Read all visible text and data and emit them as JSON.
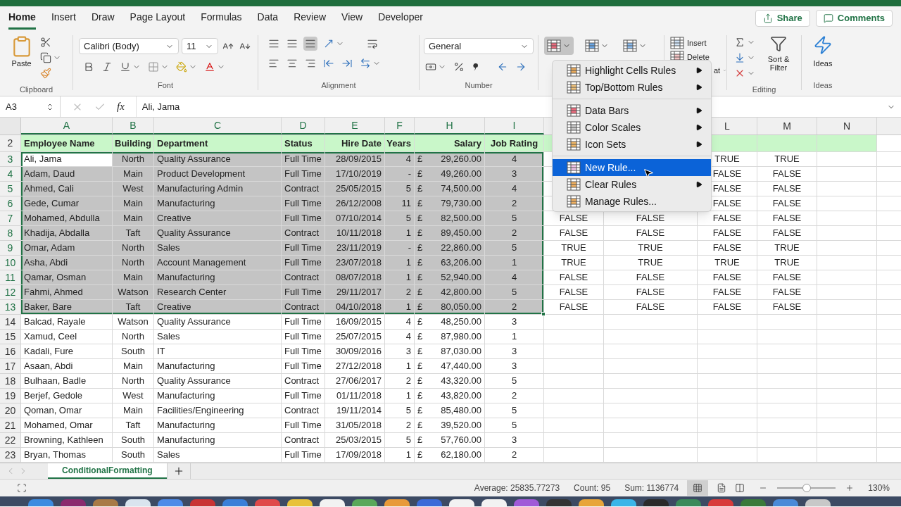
{
  "tabs": [
    {
      "label": "Home",
      "selected": true
    },
    {
      "label": "Insert",
      "selected": false
    },
    {
      "label": "Draw",
      "selected": false
    },
    {
      "label": "Page Layout",
      "selected": false
    },
    {
      "label": "Formulas",
      "selected": false
    },
    {
      "label": "Data",
      "selected": false
    },
    {
      "label": "Review",
      "selected": false
    },
    {
      "label": "View",
      "selected": false
    },
    {
      "label": "Developer",
      "selected": false
    }
  ],
  "share": "Share",
  "comments": "Comments",
  "ribbon": {
    "clipboard": {
      "paste": "Paste",
      "label": "Clipboard"
    },
    "font": {
      "name": "Calibri (Body)",
      "size": "11",
      "label": "Font"
    },
    "alignment": {
      "label": "Alignment"
    },
    "number": {
      "format": "General",
      "label": "Number"
    },
    "styles": {
      "conditional_formatting_open": true
    },
    "cells": {
      "insert": "Insert",
      "delete": "Delete",
      "format": "at"
    },
    "editing": {
      "sort_filter": "Sort & Filter",
      "label": "Editing"
    },
    "ideas": {
      "button": "Ideas",
      "label": "Ideas"
    }
  },
  "formula_bar": {
    "name_box": "A3",
    "fx": "fx",
    "value": "Ali, Jama"
  },
  "sheet": {
    "columns": [
      {
        "label": "A",
        "selected": true
      },
      {
        "label": "B",
        "selected": true
      },
      {
        "label": "C",
        "selected": true
      },
      {
        "label": "D",
        "selected": true
      },
      {
        "label": "E",
        "selected": true
      },
      {
        "label": "F",
        "selected": true
      },
      {
        "label": "H",
        "selected": true
      },
      {
        "label": "I",
        "selected": true
      },
      {},
      {},
      {
        "label": "L",
        "selected": false
      },
      {
        "label": "M",
        "selected": false
      },
      {
        "label": "N",
        "selected": false
      }
    ],
    "rows": [
      {
        "number": "2",
        "kind": "header",
        "selected": false,
        "active": false,
        "cells": [
          "Employee Name",
          "Building",
          "Department",
          "Status",
          "Hire Date",
          "Years",
          "Salary",
          "Job Rating"
        ]
      },
      {
        "number": "3",
        "kind": "data",
        "selected": true,
        "active": true,
        "cells": [
          "Ali, Jama",
          "North",
          "Quality Assurance",
          "Full Time",
          "28/09/2015",
          "4",
          {
            "currency": "£",
            "amount": "29,260.00"
          },
          "4",
          null,
          null,
          "TRUE",
          "TRUE"
        ]
      },
      {
        "number": "4",
        "kind": "data",
        "selected": true,
        "active": false,
        "cells": [
          "Adam, Daud",
          "Main",
          "Product Development",
          "Full Time",
          "17/10/2019",
          "-",
          {
            "currency": "£",
            "amount": "49,260.00"
          },
          "3",
          null,
          null,
          "FALSE",
          "FALSE"
        ]
      },
      {
        "number": "5",
        "kind": "data",
        "selected": true,
        "active": false,
        "cells": [
          "Ahmed, Cali",
          "West",
          "Manufacturing Admin",
          "Contract",
          "25/05/2015",
          "5",
          {
            "currency": "£",
            "amount": "74,500.00"
          },
          "4",
          null,
          null,
          "FALSE",
          "FALSE"
        ]
      },
      {
        "number": "6",
        "kind": "data",
        "selected": true,
        "active": false,
        "cells": [
          "Gede, Cumar",
          "Main",
          "Manufacturing",
          "Full Time",
          "26/12/2008",
          "11",
          {
            "currency": "£",
            "amount": "79,730.00"
          },
          "2",
          null,
          null,
          "FALSE",
          "FALSE"
        ]
      },
      {
        "number": "7",
        "kind": "data",
        "selected": true,
        "active": false,
        "cells": [
          "Mohamed, Abdulla",
          "Main",
          "Creative",
          "Full Time",
          "07/10/2014",
          "5",
          {
            "currency": "£",
            "amount": "82,500.00"
          },
          "5",
          "FALSE",
          "FALSE",
          "FALSE",
          "FALSE"
        ]
      },
      {
        "number": "8",
        "kind": "data",
        "selected": true,
        "active": false,
        "cells": [
          "Khadija, Abdalla",
          "Taft",
          "Quality Assurance",
          "Contract",
          "10/11/2018",
          "1",
          {
            "currency": "£",
            "amount": "89,450.00"
          },
          "2",
          "FALSE",
          "FALSE",
          "FALSE",
          "FALSE"
        ]
      },
      {
        "number": "9",
        "kind": "data",
        "selected": true,
        "active": false,
        "cells": [
          "Omar, Adam",
          "North",
          "Sales",
          "Full Time",
          "23/11/2019",
          "-",
          {
            "currency": "£",
            "amount": "22,860.00"
          },
          "5",
          "TRUE",
          "TRUE",
          "FALSE",
          "TRUE"
        ]
      },
      {
        "number": "10",
        "kind": "data",
        "selected": true,
        "active": false,
        "cells": [
          "Asha, Abdi",
          "North",
          "Account Management",
          "Full Time",
          "23/07/2018",
          "1",
          {
            "currency": "£",
            "amount": "63,206.00"
          },
          "1",
          "TRUE",
          "TRUE",
          "TRUE",
          "TRUE"
        ]
      },
      {
        "number": "11",
        "kind": "data",
        "selected": true,
        "active": false,
        "cells": [
          "Qamar, Osman",
          "Main",
          "Manufacturing",
          "Contract",
          "08/07/2018",
          "1",
          {
            "currency": "£",
            "amount": "52,940.00"
          },
          "4",
          "FALSE",
          "FALSE",
          "FALSE",
          "FALSE"
        ]
      },
      {
        "number": "12",
        "kind": "data",
        "selected": true,
        "active": false,
        "cells": [
          "Fahmi, Ahmed",
          "Watson",
          "Research Center",
          "Full Time",
          "29/11/2017",
          "2",
          {
            "currency": "£",
            "amount": "42,800.00"
          },
          "5",
          "FALSE",
          "FALSE",
          "FALSE",
          "FALSE"
        ]
      },
      {
        "number": "13",
        "kind": "data",
        "selected": true,
        "active": false,
        "cells": [
          "Baker, Bare",
          "Taft",
          "Creative",
          "Contract",
          "04/10/2018",
          "1",
          {
            "currency": "£",
            "amount": "80,050.00"
          },
          "2",
          "FALSE",
          "FALSE",
          "FALSE",
          "FALSE"
        ]
      },
      {
        "number": "14",
        "kind": "data",
        "selected": false,
        "active": false,
        "cells": [
          "Balcad, Rayale",
          "Watson",
          "Quality Assurance",
          "Full Time",
          "16/09/2015",
          "4",
          {
            "currency": "£",
            "amount": "48,250.00"
          },
          "3"
        ]
      },
      {
        "number": "15",
        "kind": "data",
        "selected": false,
        "active": false,
        "cells": [
          "Xamud, Ceel",
          "North",
          "Sales",
          "Full Time",
          "25/07/2015",
          "4",
          {
            "currency": "£",
            "amount": "87,980.00"
          },
          "1"
        ]
      },
      {
        "number": "16",
        "kind": "data",
        "selected": false,
        "active": false,
        "cells": [
          "Kadali, Fure",
          "South",
          "IT",
          "Full Time",
          "30/09/2016",
          "3",
          {
            "currency": "£",
            "amount": "87,030.00"
          },
          "3"
        ]
      },
      {
        "number": "17",
        "kind": "data",
        "selected": false,
        "active": false,
        "cells": [
          "Asaan, Abdi",
          "Main",
          "Manufacturing",
          "Full Time",
          "27/12/2018",
          "1",
          {
            "currency": "£",
            "amount": "47,440.00"
          },
          "3"
        ]
      },
      {
        "number": "18",
        "kind": "data",
        "selected": false,
        "active": false,
        "cells": [
          "Bulhaan, Badle",
          "North",
          "Quality Assurance",
          "Contract",
          "27/06/2017",
          "2",
          {
            "currency": "£",
            "amount": "43,320.00"
          },
          "5"
        ]
      },
      {
        "number": "19",
        "kind": "data",
        "selected": false,
        "active": false,
        "cells": [
          "Berjef, Gedole",
          "West",
          "Manufacturing",
          "Full Time",
          "01/11/2018",
          "1",
          {
            "currency": "£",
            "amount": "43,820.00"
          },
          "2"
        ]
      },
      {
        "number": "20",
        "kind": "data",
        "selected": false,
        "active": false,
        "cells": [
          "Qoman, Omar",
          "Main",
          "Facilities/Engineering",
          "Contract",
          "19/11/2014",
          "5",
          {
            "currency": "£",
            "amount": "85,480.00"
          },
          "5"
        ]
      },
      {
        "number": "21",
        "kind": "data",
        "selected": false,
        "active": false,
        "cells": [
          "Mohamed, Omar",
          "Taft",
          "Manufacturing",
          "Full Time",
          "31/05/2018",
          "2",
          {
            "currency": "£",
            "amount": "39,520.00"
          },
          "5"
        ]
      },
      {
        "number": "22",
        "kind": "data",
        "selected": false,
        "active": false,
        "cells": [
          "Browning, Kathleen",
          "South",
          "Manufacturing",
          "Contract",
          "25/03/2015",
          "5",
          {
            "currency": "£",
            "amount": "57,760.00"
          },
          "3"
        ]
      },
      {
        "number": "23",
        "kind": "data",
        "selected": false,
        "active": false,
        "cells": [
          "Bryan, Thomas",
          "South",
          "Sales",
          "Full Time",
          "17/09/2018",
          "1",
          {
            "currency": "£",
            "amount": "62,180.00"
          },
          "2"
        ]
      }
    ]
  },
  "menu": {
    "groups": [
      [
        {
          "label": "Highlight Cells Rules",
          "submenu": true,
          "selected": false
        },
        {
          "label": "Top/Bottom Rules",
          "submenu": true,
          "selected": false
        }
      ],
      [
        {
          "label": "Data Bars",
          "submenu": true,
          "selected": false
        },
        {
          "label": "Color Scales",
          "submenu": true,
          "selected": false
        },
        {
          "label": "Icon Sets",
          "submenu": true,
          "selected": false
        }
      ],
      [
        {
          "label": "New Rule...",
          "submenu": false,
          "selected": true
        },
        {
          "label": "Clear Rules",
          "submenu": true,
          "selected": false
        },
        {
          "label": "Manage Rules...",
          "submenu": false,
          "selected": false
        }
      ]
    ]
  },
  "sheet_tabs": [
    {
      "label": "ConditionalFormatting",
      "selected": true
    }
  ],
  "status_bar": {
    "average": "Average: 25835.77273",
    "count": "Count: 95",
    "sum": "Sum: 1136774",
    "zoom": "130%",
    "zoom_slider": {
      "level": 0.5
    }
  }
}
